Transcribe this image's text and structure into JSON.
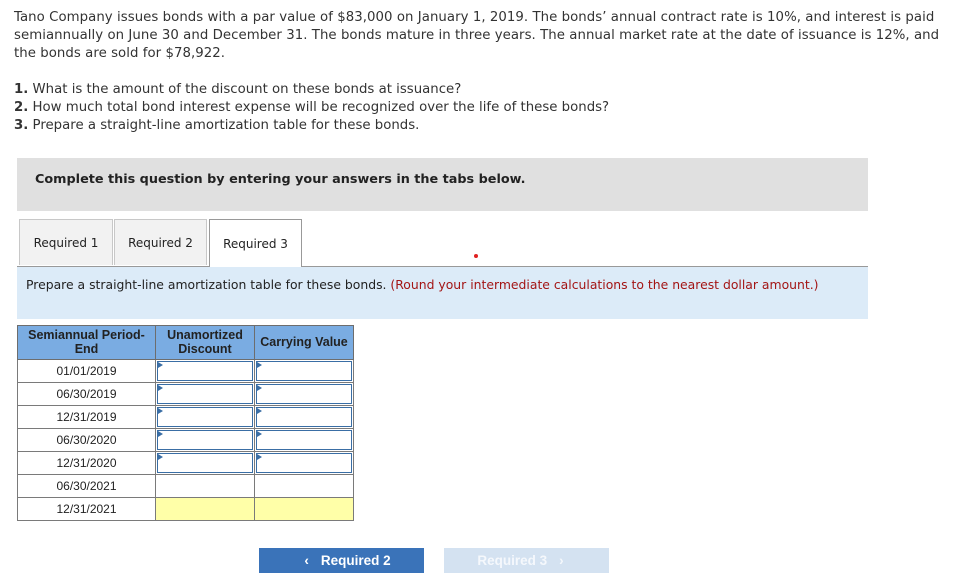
{
  "problem": {
    "text": "Tano Company issues bonds with a par value of $83,000 on January 1, 2019. The bonds’ annual contract rate is 10%, and interest is paid semiannually on June 30 and December 31. The bonds mature in three years. The annual market rate at the date of issuance is 12%, and the bonds are sold for $78,922."
  },
  "questions": [
    {
      "num": "1.",
      "text": " What is the amount of the discount on these bonds at issuance?"
    },
    {
      "num": "2.",
      "text": " How much total bond interest expense will be recognized over the life of these bonds?"
    },
    {
      "num": "3.",
      "text": " Prepare a straight-line amortization table for these bonds."
    }
  ],
  "instruction": "Complete this question by entering your answers in the tabs below.",
  "tabs": [
    {
      "label": "Required 1",
      "active": false
    },
    {
      "label": "Required 2",
      "active": false
    },
    {
      "label": "Required 3",
      "active": true
    }
  ],
  "prompt": {
    "main": "Prepare a straight-line amortization table for these bonds. ",
    "note": "(Round your intermediate calculations to the nearest dollar amount.)"
  },
  "table": {
    "headers": [
      "Semiannual Period-End",
      "Unamortized Discount",
      "Carrying Value"
    ],
    "rows": [
      {
        "date": "01/01/2019",
        "discount": "",
        "carrying": "",
        "type": "input"
      },
      {
        "date": "06/30/2019",
        "discount": "",
        "carrying": "",
        "type": "input"
      },
      {
        "date": "12/31/2019",
        "discount": "",
        "carrying": "",
        "type": "input"
      },
      {
        "date": "06/30/2020",
        "discount": "",
        "carrying": "",
        "type": "input"
      },
      {
        "date": "12/31/2020",
        "discount": "",
        "carrying": "",
        "type": "input"
      },
      {
        "date": "06/30/2021",
        "discount": "",
        "carrying": "",
        "type": "blank"
      },
      {
        "date": "12/31/2021",
        "discount": "",
        "carrying": "",
        "type": "yellow"
      }
    ]
  },
  "nav": {
    "prev_label": "Required 2",
    "next_label": "Required 3",
    "prev_icon": "chevron-left-icon",
    "next_icon": "chevron-right-icon"
  },
  "colors": {
    "tab_active_bg": "#ffffff",
    "prompt_bg": "#dcebf8",
    "header_bg": "#7aace2",
    "highlight_cell": "#ffffa8",
    "nav_prev_bg": "#3a73b9",
    "nav_next_bg": "#d4e2f1",
    "note_red": "#a31515"
  }
}
